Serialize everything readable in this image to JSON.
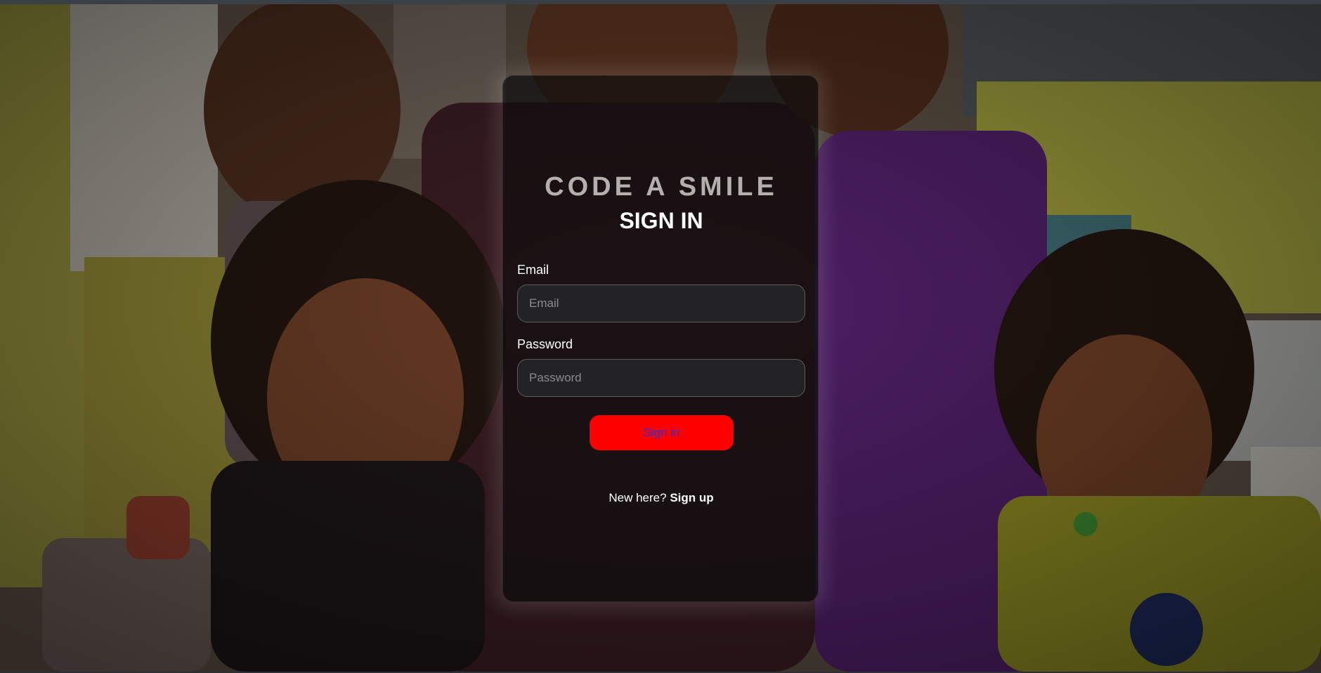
{
  "background": {
    "description_icon": "photo-background",
    "accent": "#ff0000"
  },
  "card": {
    "brand": "CODE A SMILE",
    "heading": "SIGN IN",
    "email": {
      "label": "Email",
      "placeholder": "Email",
      "value": ""
    },
    "password": {
      "label": "Password",
      "placeholder": "Password",
      "value": ""
    },
    "submit_label": "Sign in",
    "footer": {
      "prompt": "New here?",
      "link_label": "Sign up"
    }
  },
  "colors": {
    "button_bg": "#ff0000",
    "button_text": "#3a2bd4",
    "brand_text": "#b5b0ad"
  }
}
